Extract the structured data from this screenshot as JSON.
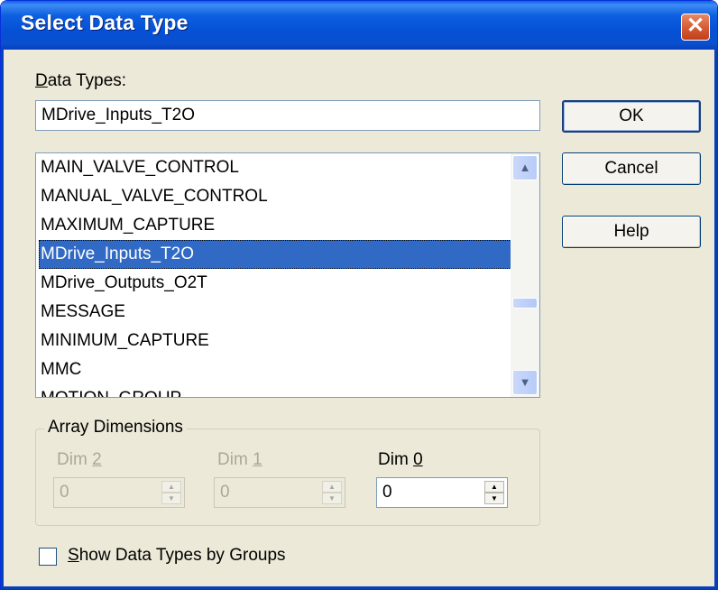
{
  "window": {
    "title": "Select Data Type",
    "close_glyph": "✕"
  },
  "data_types": {
    "label_mnemonic": "D",
    "label_rest": "ata Types:",
    "value": "MDrive_Inputs_T2O"
  },
  "buttons": {
    "ok": "OK",
    "cancel": "Cancel",
    "help": "Help"
  },
  "list": {
    "items": [
      "MAIN_VALVE_CONTROL",
      "MANUAL_VALVE_CONTROL",
      "MAXIMUM_CAPTURE",
      "MDrive_Inputs_T2O",
      "MDrive_Outputs_O2T",
      "MESSAGE",
      "MINIMUM_CAPTURE",
      "MMC",
      "MOTION_GROUP"
    ],
    "selected_index": 3,
    "scroll_up_icon": "chevron-up-icon",
    "scroll_down_icon": "chevron-down-icon"
  },
  "array_dimensions": {
    "title": "Array Dimensions",
    "dims": [
      {
        "label_prefix": "Dim ",
        "mnemonic": "2",
        "value": "0",
        "enabled": false
      },
      {
        "label_prefix": "Dim ",
        "mnemonic": "1",
        "value": "0",
        "enabled": false
      },
      {
        "label_prefix": "Dim ",
        "mnemonic": "0",
        "value": "0",
        "enabled": true
      }
    ]
  },
  "show_groups": {
    "mnemonic": "S",
    "label_rest": "how Data Types by Groups",
    "checked": false
  },
  "colors": {
    "selection": "#316ac5",
    "dialog_bg": "#ece9d8",
    "titlebar": "#0551d6",
    "close": "#d45a32"
  }
}
